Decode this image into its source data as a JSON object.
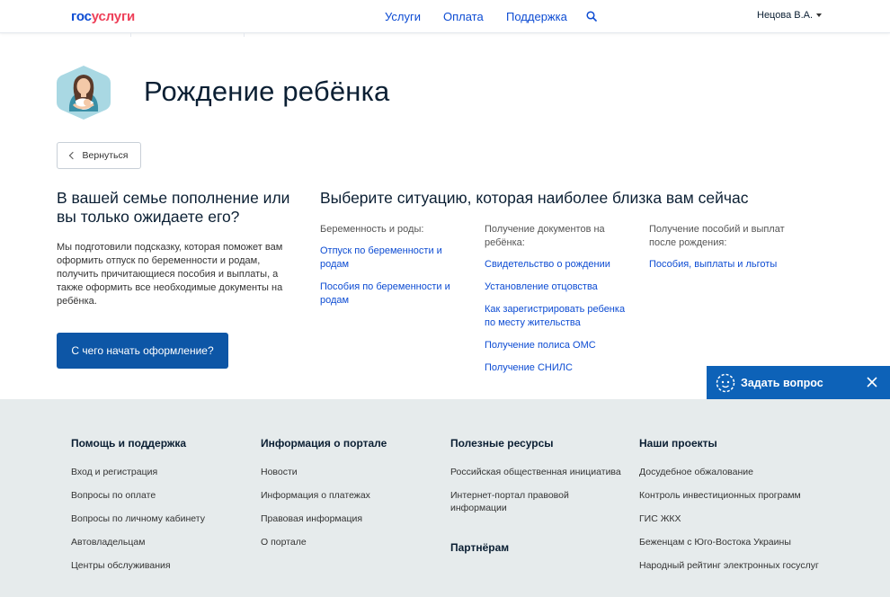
{
  "header": {
    "logo_part1": "гос",
    "logo_part2": "услуги",
    "nav": [
      "Услуги",
      "Оплата",
      "Поддержка"
    ],
    "user_name": "Нецова В.А."
  },
  "page": {
    "title": "Рождение ребёнка",
    "back_label": "Вернуться"
  },
  "left": {
    "heading": "В вашей семье пополнение или вы только ожидаете его?",
    "text": "Мы подготовили подсказку, которая поможет вам оформить отпуск по беременности и родам, получить причитающиеся пособия и выплаты, а также оформить все необходимые документы на ребёнка.",
    "button_label": "С чего начать оформление?"
  },
  "right": {
    "heading": "Выберите ситуацию, которая наиболее близка вам сейчас",
    "columns": [
      {
        "title": "Беременность и роды:",
        "links": [
          "Отпуск по беременности и родам",
          "Пособия по беременности и родам"
        ]
      },
      {
        "title": "Получение документов на ребёнка:",
        "links": [
          "Свидетельство о рождении",
          "Установление отцовства",
          "Как зарегистрировать ребенка по месту жительства",
          "Получение полиса ОМС",
          "Получение СНИЛС"
        ]
      },
      {
        "title": "Получение пособий и выплат после рождения:",
        "links": [
          "Пособия, выплаты и льготы"
        ]
      }
    ]
  },
  "chat": {
    "label": "Задать вопрос"
  },
  "footer": {
    "columns": [
      {
        "title": "Помощь и поддержка",
        "links": [
          "Вход и регистрация",
          "Вопросы по оплате",
          "Вопросы по личному кабинету",
          "Автовладельцам",
          "Центры обслуживания"
        ]
      },
      {
        "title": "Информация о портале",
        "links": [
          "Новости",
          "Информация о платежах",
          "Правовая информация",
          "О портале"
        ]
      },
      {
        "title": "Полезные ресурсы",
        "links": [
          "Российская общественная инициатива",
          "Интернет-портал правовой информации"
        ],
        "title2": "Партнёрам"
      },
      {
        "title": "Наши проекты",
        "links": [
          "Досудебное обжалование",
          "Контроль инвестиционных программ",
          "ГИС ЖКХ",
          "Беженцам с Юго-Востока Украины",
          "Народный рейтинг электронных госуслуг"
        ]
      }
    ]
  },
  "colors": {
    "link": "#0d4cd3",
    "logo_red": "#ee3f58",
    "button": "#0d56a6",
    "chat": "#0d62b8",
    "footer_bg": "#e6ebec"
  }
}
